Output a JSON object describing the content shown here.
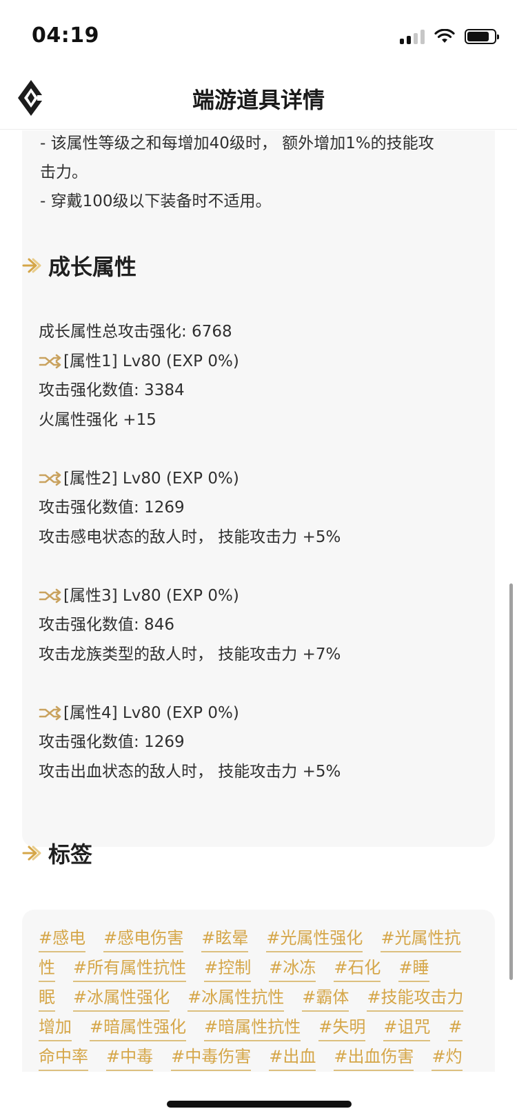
{
  "status_bar": {
    "time": "04:19"
  },
  "header": {
    "title": "端游道具详情",
    "logo_icon": "diamond-logo-icon"
  },
  "intro_card": {
    "lines": [
      "- 该属性等级之和每增加40级时， 额外增加1%的技能攻",
      "击力。",
      "- 穿戴100级以下装备时不适用。"
    ]
  },
  "growth_section": {
    "title": "成长属性",
    "total": "成长属性总攻击强化: 6768",
    "attributes": [
      {
        "header": "[属性1] Lv80 (EXP 0%)",
        "value": "攻击强化数值:  3384",
        "effect": "火属性强化 +15"
      },
      {
        "header": "[属性2] Lv80 (EXP 0%)",
        "value": "攻击强化数值:  1269",
        "effect": "攻击感电状态的敌人时，  技能攻击力 +5%"
      },
      {
        "header": "[属性3] Lv80 (EXP 0%)",
        "value": "攻击强化数值:  846",
        "effect": "攻击龙族类型的敌人时，  技能攻击力 +7%"
      },
      {
        "header": "[属性4] Lv80 (EXP 0%)",
        "value": "攻击强化数值:  1269",
        "effect": "攻击出血状态的敌人时，  技能攻击力 +5%"
      }
    ]
  },
  "tags_section": {
    "title": "标签",
    "rows": [
      [
        "#感电",
        "#感电伤害",
        "#眩晕",
        "#光属性强化",
        "#光属性抗"
      ],
      [
        "性",
        "#所有属性抗性",
        "#控制",
        "#冰冻",
        "#石化",
        "#睡"
      ],
      [
        "眠",
        "#冰属性强化",
        "#冰属性抗性",
        "#霸体",
        "#技能攻击力"
      ],
      [
        "增加",
        "#暗属性强化",
        "#暗属性抗性",
        "#失明",
        "#诅咒",
        "#"
      ],
      [
        "命中率",
        "#中毒",
        "#中毒伤害",
        "#出血",
        "#出血伤害",
        "#灼"
      ]
    ]
  },
  "colors": {
    "accent": "#d5a648",
    "card_bg": "#f7f7f7",
    "text": "#2f2f2f"
  }
}
